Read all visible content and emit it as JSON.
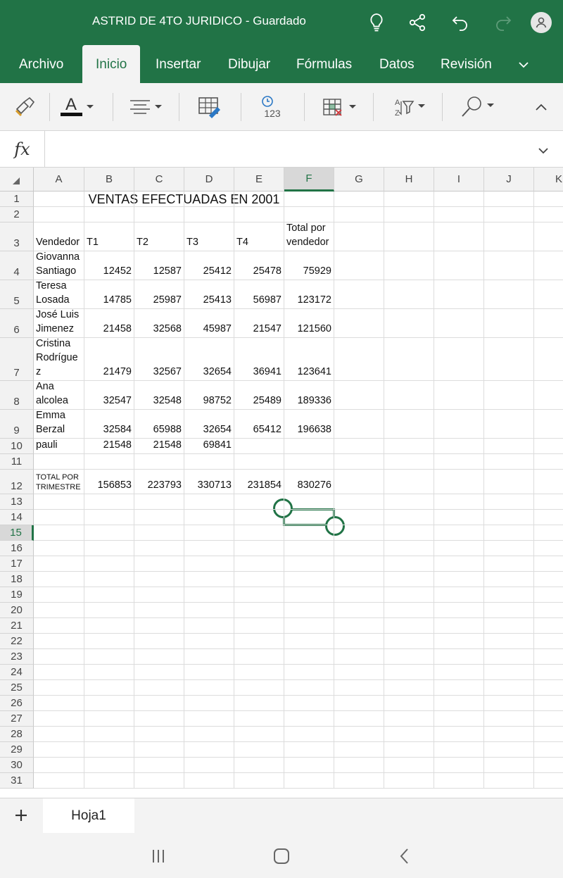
{
  "app": {
    "title": "ASTRID DE 4TO JURIDICO - Guardado"
  },
  "tabs": [
    "Archivo",
    "Inicio",
    "Insertar",
    "Dibujar",
    "Fórmulas",
    "Datos",
    "Revisión"
  ],
  "formula_bar": {
    "fx": "fx",
    "value": ""
  },
  "columns": [
    "A",
    "B",
    "C",
    "D",
    "E",
    "F",
    "G",
    "H",
    "I",
    "J",
    "K"
  ],
  "selected_column": "F",
  "selected_row": "15",
  "rows": [
    "1",
    "2",
    "3",
    "4",
    "5",
    "6",
    "7",
    "8",
    "9",
    "10",
    "11",
    "12",
    "13",
    "14",
    "15",
    "16",
    "17",
    "18",
    "19",
    "20",
    "21",
    "22",
    "23",
    "24",
    "25",
    "26",
    "27",
    "28",
    "29",
    "30",
    "31"
  ],
  "sheet": {
    "title": "VENTAS EFECTUADAS EN 2001",
    "headers": [
      "Vendedor",
      "T1",
      "T2",
      "T3",
      "T4",
      "Total por\nvendedor"
    ],
    "records": [
      [
        "Giovanna\nSantiago",
        "12452",
        "12587",
        "25412",
        "25478",
        "75929"
      ],
      [
        "Teresa\nLosada",
        "14785",
        "25987",
        "25413",
        "56987",
        "123172"
      ],
      [
        "José Luis\nJimenez",
        "21458",
        "32568",
        "45987",
        "21547",
        "121560"
      ],
      [
        "Cristina\nRodrígue\nz",
        "21479",
        "32567",
        "32654",
        "36941",
        "123641"
      ],
      [
        "Ana\nalcolea",
        "32547",
        "32548",
        "98752",
        "25489",
        "189336"
      ],
      [
        "Emma\nBerzal",
        "32584",
        "65988",
        "32654",
        "65412",
        "196638"
      ],
      [
        "Celia pauli",
        "21548",
        "21548",
        "69841",
        "",
        ""
      ]
    ],
    "totals": [
      "TOTAL POR\nTRIMESTRE",
      "156853",
      "223793",
      "330713",
      "231854",
      "830276"
    ]
  },
  "sheet_tabs": [
    "Hoja1"
  ],
  "colors": {
    "brand": "#217346",
    "ribbon": "#f3f3f3"
  }
}
